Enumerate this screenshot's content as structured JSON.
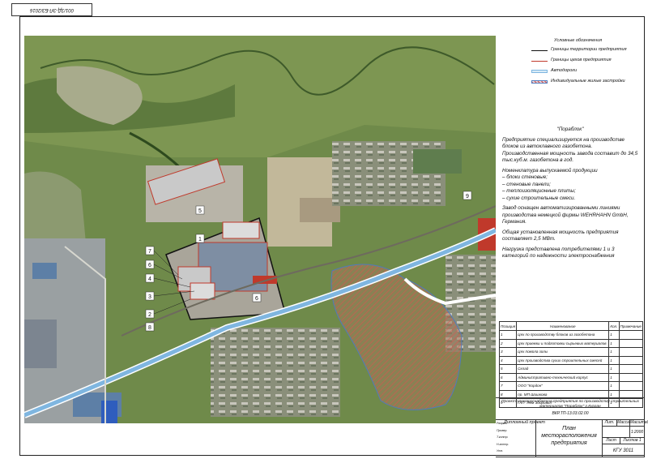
{
  "sheet": {
    "corner_code": "001/ЗД-ЭЛ-БЗ/2016"
  },
  "legend": {
    "title": "Условные обозначения",
    "items": [
      {
        "label": "Границы территории предприятия",
        "kind": "line",
        "color": "#111111"
      },
      {
        "label": "Границы цехов предприятия",
        "kind": "line",
        "color": "#c0392b"
      },
      {
        "label": "Автодороги",
        "kind": "box",
        "color": "#7fb6e0"
      },
      {
        "label": "Индивидуальные жилые застройки",
        "kind": "hatch",
        "color": "#d9534f"
      }
    ]
  },
  "description": {
    "title": "\"Пораблок\"",
    "p1": "Предприятие специализируется на производстве блоков из автоклавного газобетона. Производственная мощность завода составит до 34,5 тыс.куб.м. газобетона в год.",
    "nomenclature_title": "Номенклатура выпускаемой продукции",
    "nomenclature": [
      "– блоки стеновые;",
      "– стеновые панели;",
      "– теплоизоляционные плиты;",
      "– сухие строительные смеси."
    ],
    "p2": "Завод оснащен автоматизированными линиями производства немецкой фирмы WEHRHAHN GmbH, Германия.",
    "p3": "Общая установленная мощность предприятия составляет 2,5 МВт.",
    "p4": "Нагрузка представлена потребителями 1 и 3 категорий по надежности электроснабжения"
  },
  "map_labels": {
    "n9": "9",
    "n5": "5",
    "n1": "1",
    "n7": "7",
    "n6a": "6",
    "n6b": "6",
    "n3": "3",
    "n4": "4",
    "n2": "2",
    "n8": "8"
  },
  "spec": {
    "headers": [
      "Позиция",
      "Наименование",
      "Кол.",
      "Примечание"
    ],
    "rows": [
      {
        "pos": "1",
        "name": "Цех по производству блоков из газобетона",
        "qty": "1"
      },
      {
        "pos": "2",
        "name": "Цех приемки и подготовки сырьевых материалов",
        "qty": "1"
      },
      {
        "pos": "3",
        "name": "Цех помола золы",
        "qty": "1"
      },
      {
        "pos": "4",
        "name": "Цех производства сухих строительных смесей",
        "qty": "1"
      },
      {
        "pos": "5",
        "name": "Склад",
        "qty": "1"
      },
      {
        "pos": "6",
        "name": "Административно-технический корпус",
        "qty": "1"
      },
      {
        "pos": "7",
        "name": "ООО \"Кордон\"",
        "qty": "1"
      },
      {
        "pos": "8",
        "name": "пр. МП Шишкова",
        "qty": "1"
      },
      {
        "pos": "9",
        "name": "ГАП \"Лем Здоровья\"",
        "qty": "1"
      }
    ]
  },
  "stamp": {
    "note": "Проект электроснабжения предприятия по производству строительных материалов \"Пораблок\" г.Курган",
    "code": "ВКР.ТП-13.03.02.00",
    "project_type": "Дипломный проект",
    "sheet_title": "План месторасположения предприятия",
    "scale": "1:2000",
    "org": "КГУ 3011",
    "lit_label": "Лит.",
    "mass_label": "Масса",
    "scale_label": "Масштаб",
    "sheet_label": "Лист",
    "sheets_label": "Листов 1",
    "role_labels": [
      "Разраб.",
      "Провер.",
      "Т.контр.",
      "Н.контр.",
      "Утв."
    ]
  }
}
